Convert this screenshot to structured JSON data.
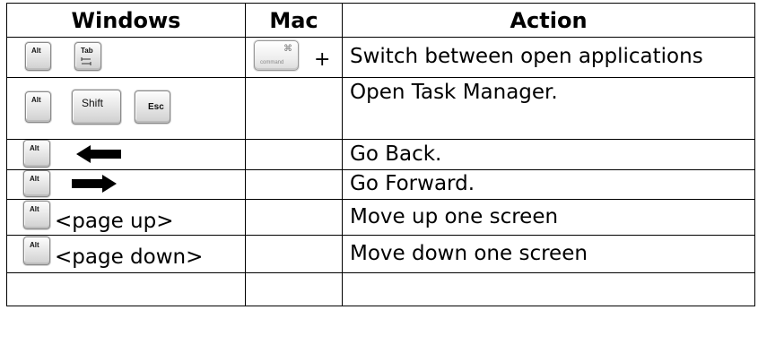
{
  "headers": {
    "windows": "Windows",
    "mac": "Mac",
    "action": "Action"
  },
  "keys": {
    "alt": "Alt",
    "tab": "Tab",
    "shift": "Shift",
    "esc": "Esc",
    "command": "command",
    "command_symbol": "⌘"
  },
  "plus": "+",
  "rows": [
    {
      "action": "Switch between open applications"
    },
    {
      "action": "Open Task Manager."
    },
    {
      "action": "Go Back.",
      "arrow": "left-arrow-icon"
    },
    {
      "action": "Go Forward.",
      "arrow": "right-arrow-icon"
    },
    {
      "action": "Move up one screen",
      "key_text": "<page up>"
    },
    {
      "action": "Move down one screen",
      "key_text": "<page down>"
    },
    {
      "action": ""
    }
  ]
}
